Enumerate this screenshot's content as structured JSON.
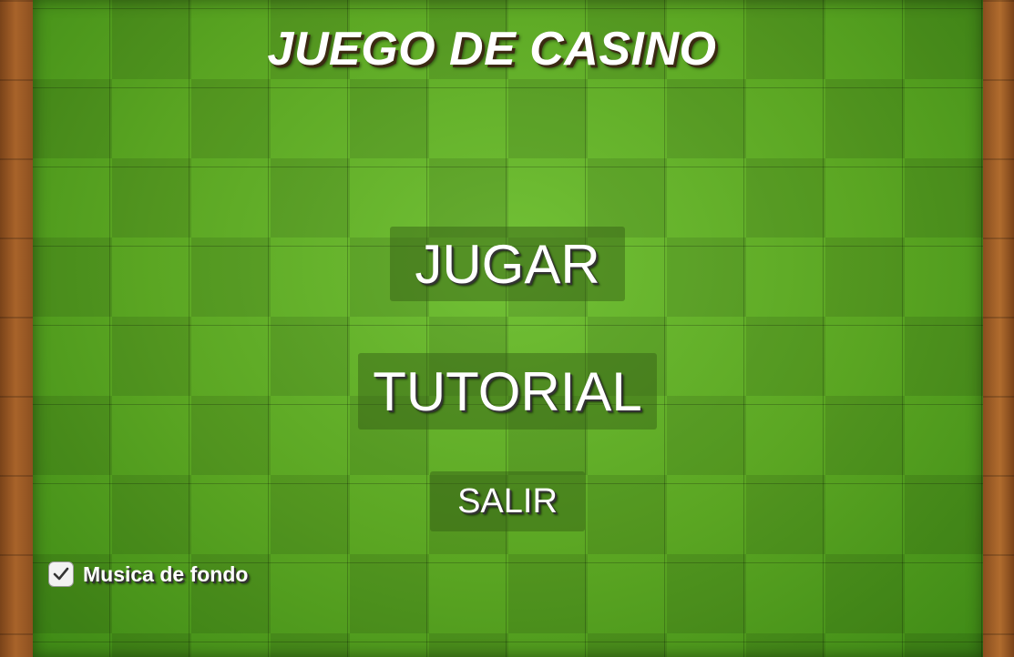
{
  "game": {
    "title": "JUEGO DE CASINO"
  },
  "menu": {
    "play_label": "JUGAR",
    "tutorial_label": "TUTORIAL",
    "exit_label": "SALIR"
  },
  "settings": {
    "music_label": "Musica de fondo",
    "music_checked": true,
    "checkbox_icon": "checkmark-icon"
  },
  "colors": {
    "felt_green": "#5aa522",
    "wood_border": "#a8632a",
    "text": "#ffffff"
  }
}
